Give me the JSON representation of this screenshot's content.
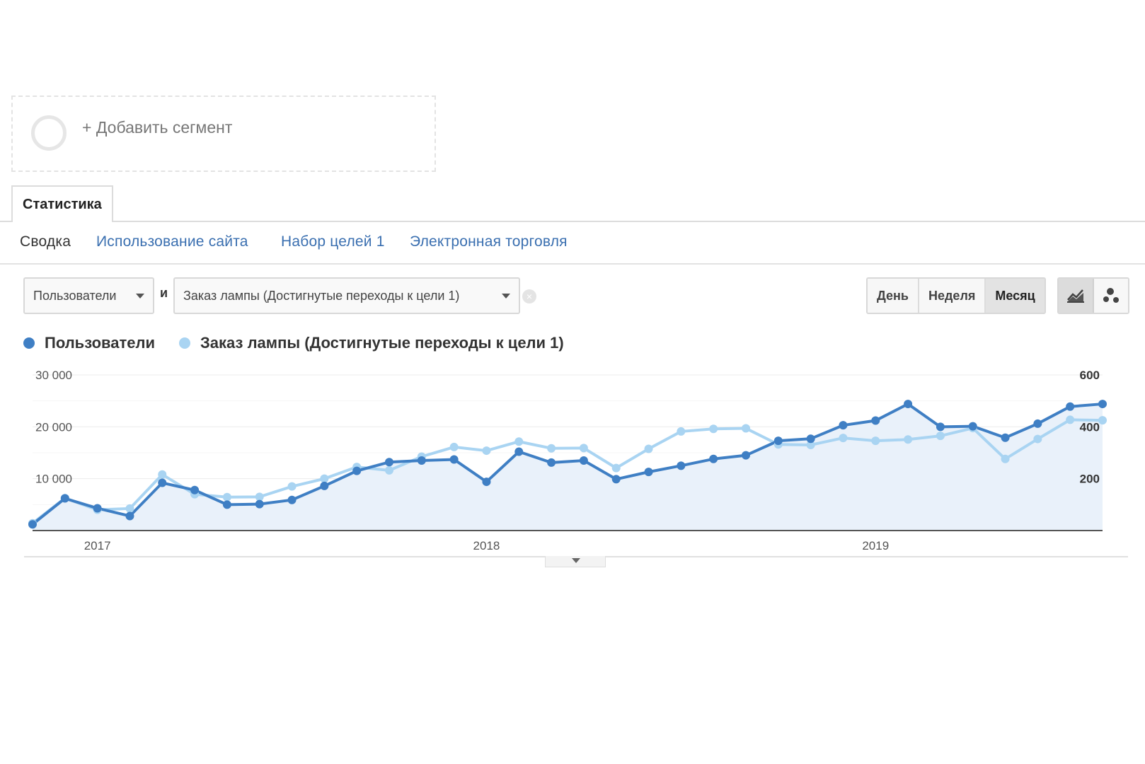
{
  "segment": {
    "add_label": "+ Добавить сегмент"
  },
  "tabs": [
    {
      "label": "Статистика",
      "active": true
    }
  ],
  "subnav": {
    "items": [
      {
        "label": "Сводка",
        "current": true
      },
      {
        "label": "Использование сайта",
        "current": false
      },
      {
        "label": "Набор целей 1",
        "current": false
      },
      {
        "label": "Электронная торговля",
        "current": false
      }
    ]
  },
  "controls": {
    "metric_primary": "Пользователи",
    "and_label": "и",
    "metric_secondary": "Заказ лампы (Достигнутые переходы к цели 1)",
    "granularity": [
      {
        "label": "День",
        "active": false
      },
      {
        "label": "Неделя",
        "active": false
      },
      {
        "label": "Месяц",
        "active": true
      }
    ],
    "chart_modes": [
      {
        "icon": "line-chart-icon",
        "active": true
      },
      {
        "icon": "motion-chart-icon",
        "active": false
      }
    ]
  },
  "colors": {
    "primary": "#3f7fc4",
    "secondary": "#a9d4f2",
    "fill": "#e9f1fa"
  },
  "chart_data": {
    "type": "line",
    "x_tick_labels": [
      "2017",
      "2018",
      "2019"
    ],
    "y_left": {
      "min": 0,
      "max": 30000,
      "ticks": [
        10000,
        20000,
        30000
      ],
      "tick_labels": [
        "10 000",
        "20 000",
        "30 000"
      ]
    },
    "y_right": {
      "min": 0,
      "max": 600,
      "ticks": [
        200,
        400,
        600
      ],
      "tick_labels": [
        "200",
        "400",
        "600"
      ]
    },
    "grid": true,
    "legend_position": "top-left",
    "series": [
      {
        "name": "Пользователи",
        "axis": "left",
        "area": true,
        "values": [
          1200,
          6200,
          4300,
          2800,
          9200,
          7800,
          5000,
          5100,
          5900,
          8600,
          11500,
          13200,
          13500,
          13700,
          9400,
          15200,
          13100,
          13500,
          9900,
          11300,
          12500,
          13800,
          14500,
          17300,
          17700,
          20300,
          21200,
          24400,
          20000,
          20100,
          17900,
          20600,
          23900,
          24400
        ]
      },
      {
        "name": "Заказ лампы (Достигнутые переходы к цели 1)",
        "axis": "right",
        "area": false,
        "values": [
          28,
          125,
          80,
          85,
          216,
          140,
          129,
          130,
          170,
          200,
          245,
          232,
          285,
          322,
          308,
          343,
          317,
          318,
          241,
          315,
          382,
          392,
          394,
          332,
          330,
          357,
          346,
          351,
          365,
          395,
          276,
          353,
          427,
          425
        ]
      }
    ]
  }
}
